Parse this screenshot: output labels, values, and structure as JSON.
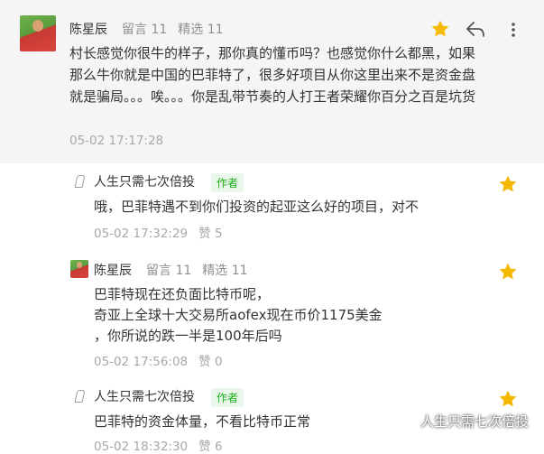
{
  "top": {
    "name": "陈星辰",
    "likes": "留言 11",
    "picks": "精选 11",
    "text": "村长感觉你很牛的样子，那你真的懂币吗？也感觉你什么都黑，如果那么牛你就是中国的巴菲特了，很多好项目从你这里出来不是资金盘就是骗局。。。唉。。。你是乱带节奏的人打王者荣耀你百分之百是坑货",
    "time": "05-02 17:17:28"
  },
  "replies": [
    {
      "name": "人生只需七次倍投",
      "tag": "作者",
      "text": "哦，巴菲特遇不到你们投资的起亚这么好的项目，对不",
      "time": "05-02 17:32:29",
      "likes": "赞 5"
    },
    {
      "name": "陈星辰",
      "likes_meta": "留言 11",
      "picks_meta": "精选 11",
      "line1": "巴菲特现在还负面比特币呢，",
      "line2": "奇亚上全球十大交易所aofex现在币价1175美金",
      "line3": "，你所说的跌一半是100年后吗",
      "time": "05-02 17:56:08",
      "likes": "赞 0"
    },
    {
      "name": "人生只需七次倍投",
      "tag": "作者",
      "text": "巴菲特的资金体量，不看比特币正常",
      "time": "05-02 18:32:30",
      "likes": "赞 6"
    }
  ],
  "watermark": "人生只需七次倍投",
  "colors": {
    "star": "#f5b800",
    "tag_green": "#1aad19",
    "top_bg": "#f5f5f5"
  }
}
